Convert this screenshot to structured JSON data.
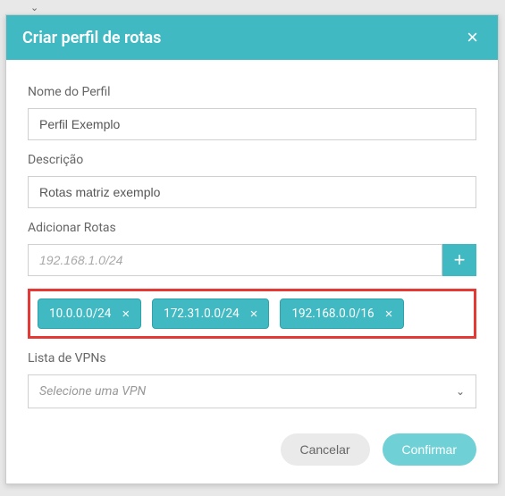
{
  "modal": {
    "title": "Criar perfil de rotas",
    "fields": {
      "profileName": {
        "label": "Nome do Perfil",
        "value": "Perfil Exemplo"
      },
      "description": {
        "label": "Descrição",
        "value": "Rotas matriz exemplo"
      },
      "addRoutes": {
        "label": "Adicionar Rotas",
        "placeholder": "192.168.1.0/24",
        "chips": [
          "10.0.0.0/24",
          "172.31.0.0/24",
          "192.168.0.0/16"
        ]
      },
      "vpnList": {
        "label": "Lista de VPNs",
        "placeholder": "Selecione uma VPN"
      }
    },
    "actions": {
      "cancel": "Cancelar",
      "confirm": "Confirmar"
    }
  },
  "colors": {
    "primary": "#41b9c2",
    "highlight": "#e53935"
  }
}
